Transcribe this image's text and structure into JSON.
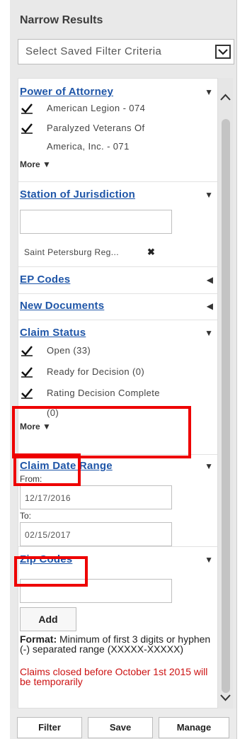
{
  "panel": {
    "title": "Narrow Results"
  },
  "saved_filter": {
    "placeholder": "Select Saved Filter Criteria",
    "icon": "chevron-down-icon"
  },
  "power_of_attorney": {
    "title": "Power of Attorney",
    "items": [
      {
        "label": "American Legion - 074",
        "checked": true
      },
      {
        "label_line1": "Paralyzed Veterans Of",
        "label_line2": "America, Inc. - 071",
        "checked": true
      }
    ],
    "more": "More ▼"
  },
  "station": {
    "title": "Station of Jurisdiction",
    "input_value": "",
    "chip": "Saint Petersburg Reg...",
    "chip_remove": "✖"
  },
  "ep_codes": {
    "title": "EP Codes"
  },
  "new_documents": {
    "title": "New Documents"
  },
  "claim_status": {
    "title": "Claim Status",
    "items": [
      {
        "label": "Open (33)",
        "checked": true
      },
      {
        "label": "Ready for Decision (0)",
        "checked": true
      },
      {
        "label_line1": "Rating Decision Complete",
        "label_line2": "(0)",
        "checked": true
      }
    ],
    "more": "More ▼"
  },
  "claim_date_range": {
    "title": "Claim Date Range",
    "from_label": "From:",
    "from_value": "12/17/2016",
    "to_label": "To:",
    "to_value": "02/15/2017"
  },
  "zip_codes": {
    "title": "Zip Codes",
    "input_value": "",
    "add_label": "Add",
    "format_bold": "Format:",
    "format_text": " Minimum of first 3 digits or hyphen (-) separated range (XXXXX-XXXXX)",
    "warning": "Claims closed before October 1st 2015 will be temporarily"
  },
  "footer": {
    "filter": "Filter",
    "save": "Save",
    "manage": "Manage"
  },
  "colors": {
    "link": "#1f56a8",
    "highlight": "#ee0000",
    "warning": "#cc1111"
  }
}
